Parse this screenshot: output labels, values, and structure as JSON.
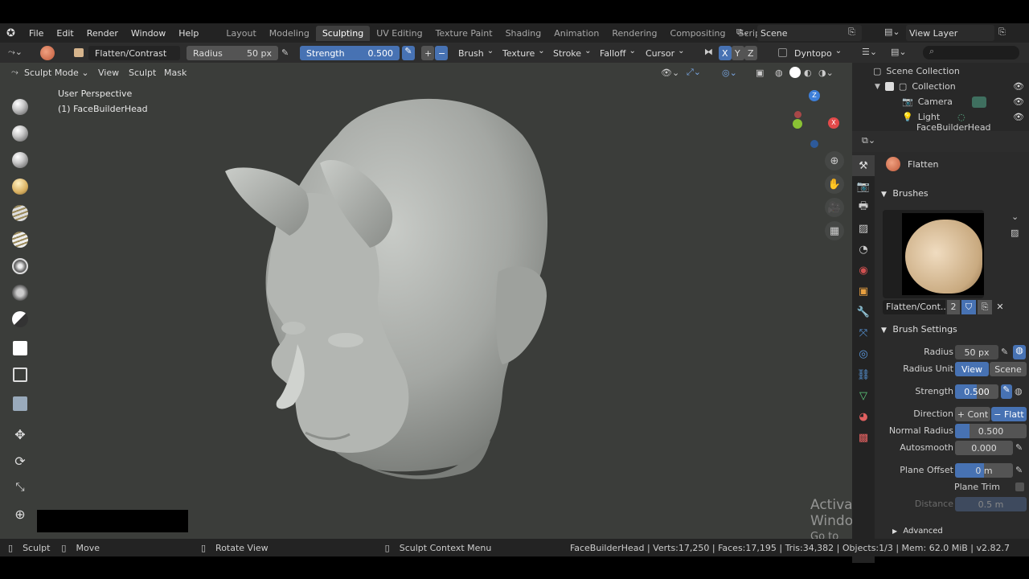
{
  "menu": [
    "File",
    "Edit",
    "Render",
    "Window",
    "Help"
  ],
  "workspaces": [
    "Layout",
    "Modeling",
    "Sculpting",
    "UV Editing",
    "Texture Paint",
    "Shading",
    "Animation",
    "Rendering",
    "Compositing",
    "Scripting"
  ],
  "active_workspace": "Sculpting",
  "scene_name": "Scene",
  "view_layer": "View Layer",
  "tool_header": {
    "brush_name": "Flatten/Contrast",
    "radius_label": "Radius",
    "radius_value": "50 px",
    "strength_label": "Strength",
    "strength_value": "0.500",
    "plus": "+",
    "minus": "−",
    "brush": "Brush",
    "texture": "Texture",
    "stroke": "Stroke",
    "falloff": "Falloff",
    "cursor": "Cursor",
    "x": "X",
    "y": "Y",
    "z": "Z",
    "dyntopo": "Dyntopo"
  },
  "viewport_header": {
    "mode": "Sculpt Mode",
    "view": "View",
    "sculpt": "Sculpt",
    "mask": "Mask"
  },
  "viewport_info": {
    "perspective": "User Perspective",
    "object": "(1) FaceBuilderHead"
  },
  "outliner": {
    "root": "Scene Collection",
    "items": [
      "Collection",
      "Camera",
      "Light",
      "FaceBuilderHead"
    ]
  },
  "properties": {
    "tool_name": "Flatten",
    "brushes_title": "Brushes",
    "brush_name": "Flatten/Cont..",
    "brush_users": "2",
    "brush_settings_title": "Brush Settings",
    "radius_label": "Radius",
    "radius_value": "50 px",
    "radius_unit_label": "Radius Unit",
    "radius_unit_view": "View",
    "radius_unit_scene": "Scene",
    "strength_label": "Strength",
    "strength_value": "0.500",
    "direction_label": "Direction",
    "direction_contrast": "+ Cont",
    "direction_flatten": "− Flatt",
    "normal_radius_label": "Normal Radius",
    "normal_radius_value": "0.500",
    "autosmooth_label": "Autosmooth",
    "autosmooth_value": "0.000",
    "plane_offset_label": "Plane Offset",
    "plane_offset_value": "0 m",
    "plane_trim_label": "Plane Trim",
    "distance_label": "Distance",
    "distance_value": "0.5 m",
    "advanced_label": "Advanced"
  },
  "watermark": {
    "line1": "Activate Windows",
    "line2": "Go to Settings to activate Windows."
  },
  "statusbar": {
    "sculpt": "Sculpt",
    "move": "Move",
    "rotate": "Rotate View",
    "context": "Sculpt Context Menu",
    "stats": "FaceBuilderHead | Verts:17,250 | Faces:17,195 | Tris:34,382 | Objects:1/3 | Mem: 62.0 MiB | v2.82.7"
  },
  "colors": {
    "accent_blue": "#4772b3",
    "viewport_bg": "#3b3d3a",
    "panel_bg": "#2b2b2b"
  }
}
